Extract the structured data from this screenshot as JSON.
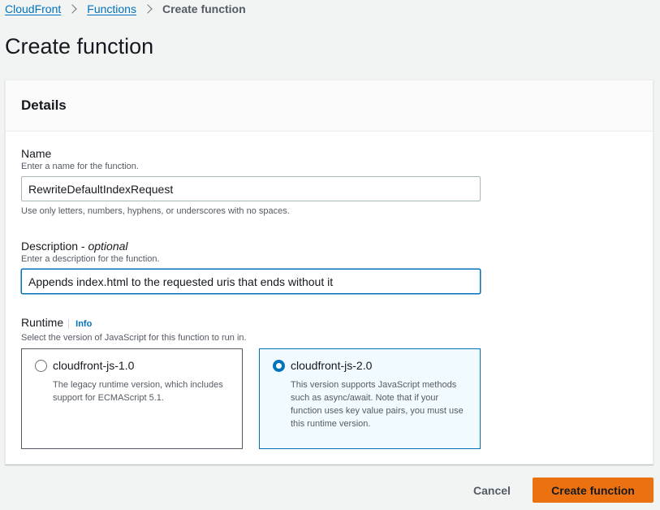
{
  "breadcrumb": {
    "items": [
      "CloudFront",
      "Functions"
    ],
    "current": "Create function"
  },
  "page_title": "Create function",
  "details": {
    "heading": "Details",
    "name": {
      "label": "Name",
      "description": "Enter a name for the function.",
      "value": "RewriteDefaultIndexRequest",
      "constraint": "Use only letters, numbers, hyphens, or underscores with no spaces."
    },
    "description_field": {
      "label": "Description - ",
      "optional": "optional",
      "description": "Enter a description for the function.",
      "value": "Appends index.html to the requested uris that ends without it"
    },
    "runtime": {
      "label": "Runtime",
      "info": "Info",
      "description": "Select the version of JavaScript for this function to run in.",
      "options": [
        {
          "title": "cloudfront-js-1.0",
          "description": "The legacy runtime version, which includes support for ECMAScript 5.1.",
          "selected": false
        },
        {
          "title": "cloudfront-js-2.0",
          "description": "This version supports JavaScript methods such as async/await. Note that if your function uses key value pairs, you must use this runtime version.",
          "selected": true
        }
      ]
    }
  },
  "actions": {
    "cancel": "Cancel",
    "create": "Create function"
  },
  "colors": {
    "accent": "#0073bb",
    "primary_button": "#ec7211"
  }
}
